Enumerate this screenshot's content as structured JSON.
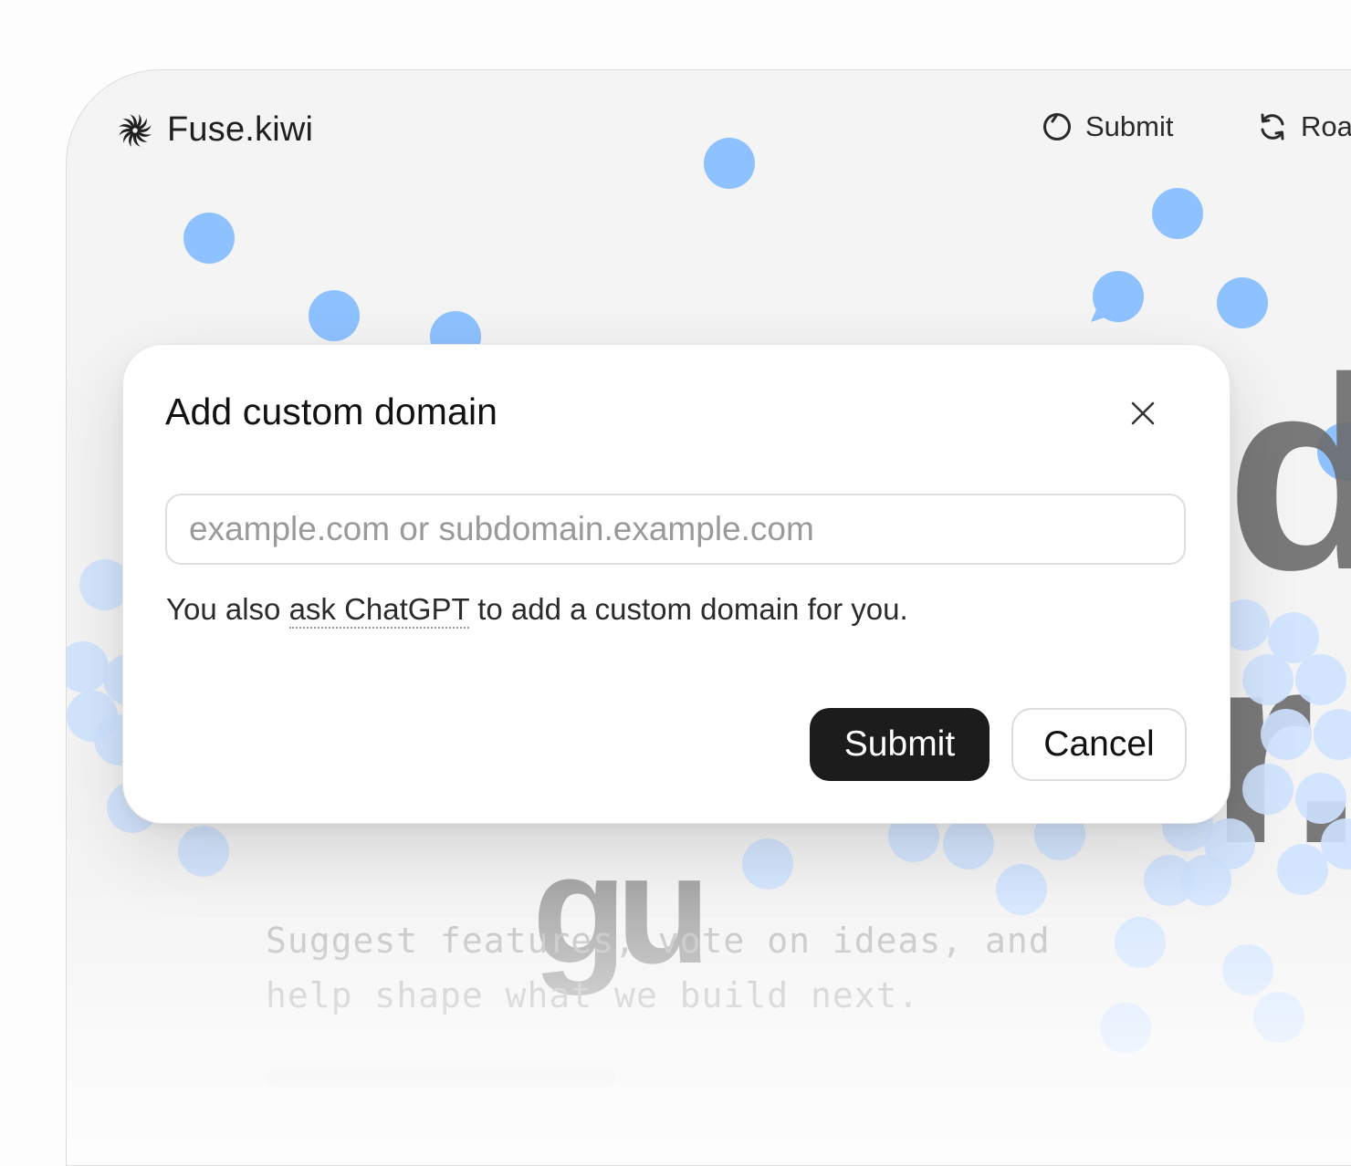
{
  "app": {
    "brand": "Fuse.kiwi",
    "logo_icon": "spiral-burst-icon"
  },
  "nav": {
    "items": [
      {
        "label": "Submit",
        "icon": "circle-icon"
      },
      {
        "label": "Roa",
        "icon": "refresh-icon"
      }
    ]
  },
  "hero": {
    "title_fragments": [
      "de",
      "r.",
      "gu"
    ],
    "subtitle": "Suggest features, vote on ideas, and help shape what we build next."
  },
  "modal": {
    "title": "Add custom domain",
    "close_icon": "close-icon",
    "input": {
      "value": "",
      "placeholder": "example.com or subdomain.example.com"
    },
    "helper_before": "You also ",
    "helper_link": "ask ChatGPT",
    "helper_after": " to add a custom domain for you.",
    "submit_label": "Submit",
    "cancel_label": "Cancel"
  },
  "colors": {
    "accent_dots": "#8ec1ff",
    "primary_button": "#1c1c1c",
    "background": "#f4f4f4"
  }
}
